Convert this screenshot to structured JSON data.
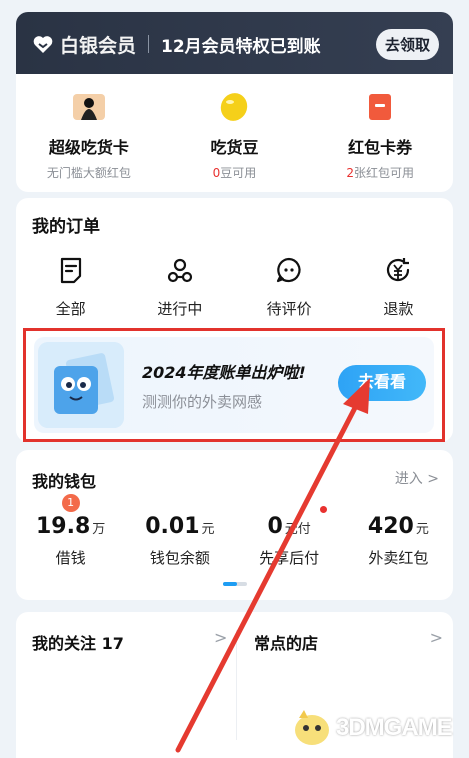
{
  "member": {
    "title": "白银会员",
    "message": "12月会员特权已到账",
    "button": "去领取"
  },
  "top_items": [
    {
      "name": "超级吃货卡",
      "sub": "无门槛大额红包",
      "icon": "super-card-icon"
    },
    {
      "name": "吃货豆",
      "sub_prefix": "0",
      "sub_suffix": "豆可用",
      "icon": "bean-icon"
    },
    {
      "name": "红包卡券",
      "sub_prefix": "2",
      "sub_suffix": "张红包可用",
      "icon": "red-packet-icon"
    }
  ],
  "orders": {
    "title": "我的订单",
    "items": [
      {
        "label": "全部",
        "icon": "order-all-icon"
      },
      {
        "label": "进行中",
        "icon": "delivery-scooter-icon"
      },
      {
        "label": "待评价",
        "icon": "comment-icon"
      },
      {
        "label": "退款",
        "icon": "refund-icon"
      }
    ]
  },
  "banner": {
    "title": "2024年度账单出炉啦!",
    "subtitle": "测测你的外卖网感",
    "button": "去看看"
  },
  "wallet": {
    "title": "我的钱包",
    "enter": "进入 >",
    "items": [
      {
        "value": "19.8",
        "unit": "万",
        "label": "借钱",
        "badge": "1"
      },
      {
        "value": "0.01",
        "unit": "元",
        "label": "钱包余额"
      },
      {
        "value": "0",
        "unit": "元付",
        "label": "先享后付"
      },
      {
        "value": "420",
        "unit": "元",
        "label": "外卖红包"
      }
    ]
  },
  "follow": {
    "title": "我的关注 17",
    "arrow": ">"
  },
  "shops": {
    "title": "常点的店",
    "arrow": ">"
  },
  "watermark": {
    "text": "3DMGAME"
  },
  "colors": {
    "accent_blue": "#2ea3f5",
    "highlight_red": "#e2322c",
    "member_bar": "#2a3344"
  }
}
